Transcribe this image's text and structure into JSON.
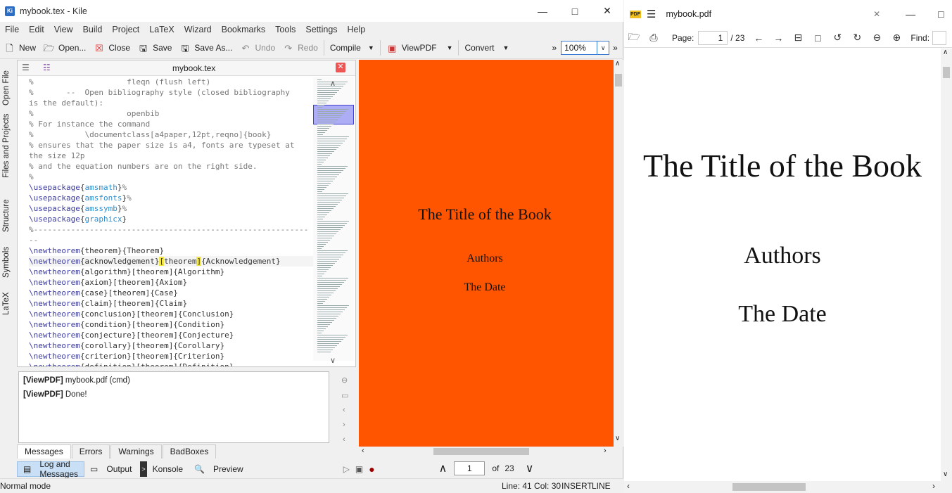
{
  "kile": {
    "window_title": "mybook.tex - Kile",
    "app_icon": "Ki",
    "menu": [
      "File",
      "Edit",
      "View",
      "Build",
      "Project",
      "LaTeX",
      "Wizard",
      "Bookmarks",
      "Tools",
      "Settings",
      "Help"
    ],
    "toolbar": {
      "new": "New",
      "open": "Open...",
      "close": "Close",
      "save": "Save",
      "save_as": "Save As...",
      "undo": "Undo",
      "redo": "Redo",
      "compile": "Compile",
      "viewpdf": "ViewPDF",
      "convert": "Convert",
      "zoom": "100%"
    },
    "side_tabs": [
      "Open File",
      "Files and Projects",
      "Structure",
      "Symbols",
      "LaTeX"
    ],
    "editor": {
      "tab_title": "mybook.tex",
      "lines": [
        {
          "t": "c",
          "s": "%                    fleqn (flush left)"
        },
        {
          "t": "c",
          "s": "%       --  Open bibliography style (closed bibliography"
        },
        {
          "t": "c",
          "s": "is the default):"
        },
        {
          "t": "c",
          "s": "%                    openbib"
        },
        {
          "t": "c",
          "s": "% For instance the command"
        },
        {
          "t": "c",
          "s": "%           \\documentclass[a4paper,12pt,reqno]{book}"
        },
        {
          "t": "c",
          "s": "% ensures that the paper size is a4, fonts are typeset at"
        },
        {
          "t": "c",
          "s": "the size 12p"
        },
        {
          "t": "c",
          "s": "% and the equation numbers are on the right side."
        },
        {
          "t": "c",
          "s": "%"
        },
        {
          "t": "u",
          "cmd": "\\usepackage",
          "a1": "amsmath",
          "rest": "%"
        },
        {
          "t": "u",
          "cmd": "\\usepackage",
          "a1": "amsfonts",
          "rest": "%"
        },
        {
          "t": "u",
          "cmd": "\\usepackage",
          "a1": "amssymb",
          "rest": "%"
        },
        {
          "t": "u",
          "cmd": "\\usepackage",
          "a1": "graphicx",
          "rest": ""
        },
        {
          "t": "c",
          "s": "%-----------------------------------------------------------"
        },
        {
          "t": "c",
          "s": "--"
        },
        {
          "t": "n",
          "cmd": "\\newtheorem",
          "s": "{theorem}{Theorem}"
        },
        {
          "t": "h",
          "cmd": "\\newtheorem",
          "s1": "{acknowledgement}",
          "h1": "[",
          "s2": "t",
          "hl2": "heorem",
          "h2": "]",
          "s3": "{Acknowledgement}"
        },
        {
          "t": "n",
          "cmd": "\\newtheorem",
          "s": "{algorithm}[theorem]{Algorithm}"
        },
        {
          "t": "n",
          "cmd": "\\newtheorem",
          "s": "{axiom}[theorem]{Axiom}"
        },
        {
          "t": "n",
          "cmd": "\\newtheorem",
          "s": "{case}[theorem]{Case}"
        },
        {
          "t": "n",
          "cmd": "\\newtheorem",
          "s": "{claim}[theorem]{Claim}"
        },
        {
          "t": "n",
          "cmd": "\\newtheorem",
          "s": "{conclusion}[theorem]{Conclusion}"
        },
        {
          "t": "n",
          "cmd": "\\newtheorem",
          "s": "{condition}[theorem]{Condition}"
        },
        {
          "t": "n",
          "cmd": "\\newtheorem",
          "s": "{conjecture}[theorem]{Conjecture}"
        },
        {
          "t": "n",
          "cmd": "\\newtheorem",
          "s": "{corollary}[theorem]{Corollary}"
        },
        {
          "t": "n",
          "cmd": "\\newtheorem",
          "s": "{criterion}[theorem]{Criterion}"
        },
        {
          "t": "n",
          "cmd": "\\newtheorem",
          "s": "{definition}[theorem]{Definition}"
        }
      ]
    },
    "log": [
      {
        "tag": "[ViewPDF]",
        "msg": " mybook.pdf (cmd)"
      },
      {
        "tag": "[ViewPDF]",
        "msg": " Done!"
      }
    ],
    "log_tabs": [
      "Messages",
      "Errors",
      "Warnings",
      "BadBoxes"
    ],
    "bottom_tabs": [
      "Log and Messages",
      "Output",
      "Konsole",
      "Preview"
    ],
    "status": {
      "mode": "Normal mode",
      "position": "Line: 41 Col: 30",
      "insert": "INSERT",
      "line": "LINE"
    },
    "preview": {
      "bg_color": "#ff5500",
      "title": "The Title of the Book",
      "authors": "Authors",
      "date": "The Date",
      "page": "1",
      "of": "of",
      "total": "23"
    }
  },
  "okular": {
    "window_title": "mybook.pdf",
    "page_label": "Page:",
    "page": "1",
    "total": "/ 23",
    "find_label": "Find:",
    "title": "The Title of the Book",
    "authors": "Authors",
    "date": "The Date"
  }
}
